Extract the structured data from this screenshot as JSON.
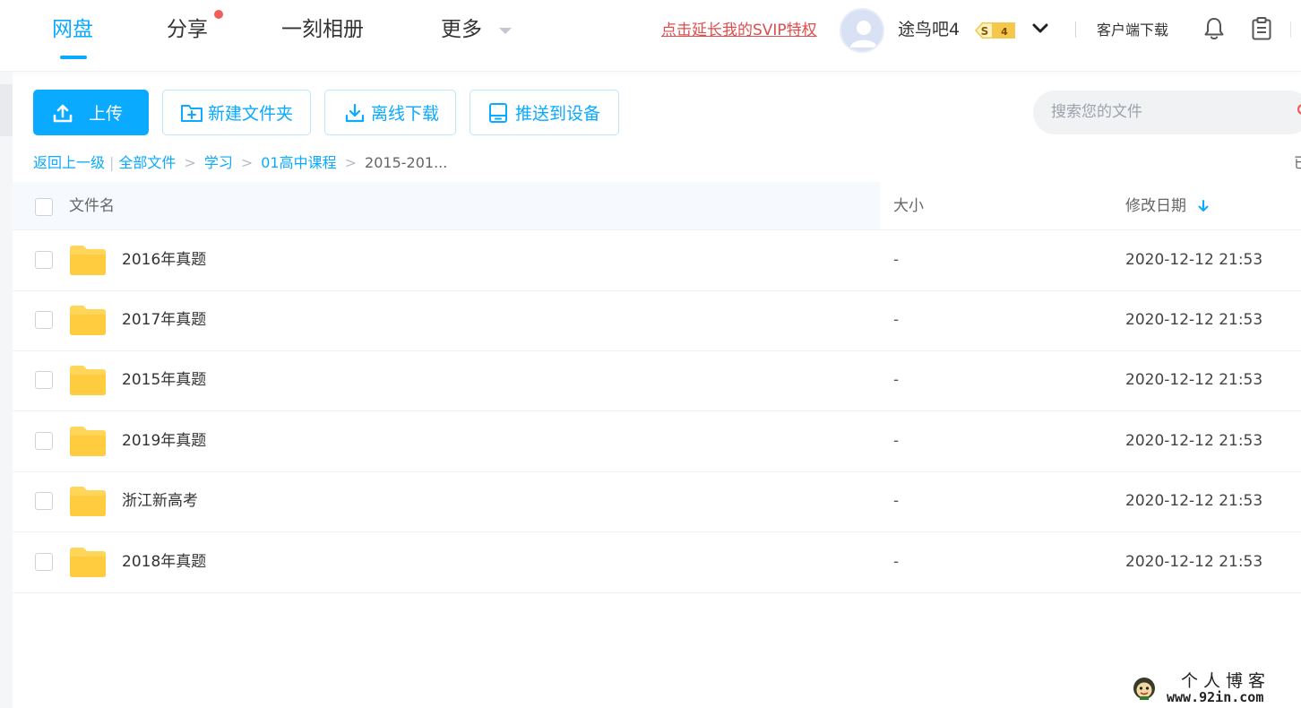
{
  "nav": {
    "tabs": [
      {
        "label": "网盘",
        "active": true
      },
      {
        "label": "分享",
        "has_notification_dot": true
      },
      {
        "label": "一刻相册"
      },
      {
        "label": "更多",
        "has_dropdown": true
      }
    ]
  },
  "header": {
    "svip_link": "点击延长我的SVIP特权",
    "username": "途鸟吧4",
    "vip_badge": {
      "letter": "S",
      "level": "4"
    },
    "client_download": "客户端下载"
  },
  "toolbar": {
    "upload": "上传",
    "new_folder": "新建文件夹",
    "offline_download": "离线下载",
    "push_to_device": "推送到设备"
  },
  "search": {
    "placeholder": "搜索您的文件"
  },
  "breadcrumb": {
    "back": "返回上一级",
    "items": [
      "全部文件",
      "学习",
      "01高中课程"
    ],
    "current": "2015-201...",
    "right_status": "已"
  },
  "table": {
    "columns": {
      "name": "文件名",
      "size": "大小",
      "modified": "修改日期"
    },
    "rows": [
      {
        "name": "2016年真题",
        "size": "-",
        "modified": "2020-12-12 21:53"
      },
      {
        "name": "2017年真题",
        "size": "-",
        "modified": "2020-12-12 21:53"
      },
      {
        "name": "2015年真题",
        "size": "-",
        "modified": "2020-12-12 21:53"
      },
      {
        "name": "2019年真题",
        "size": "-",
        "modified": "2020-12-12 21:53"
      },
      {
        "name": "浙江新高考",
        "size": "-",
        "modified": "2020-12-12 21:53"
      },
      {
        "name": "2018年真题",
        "size": "-",
        "modified": "2020-12-12 21:53"
      }
    ]
  },
  "watermark": {
    "title": "个人博客",
    "url": "www.92in.com"
  },
  "colors": {
    "accent": "#09aaff",
    "notification": "#f25d59",
    "svip_link": "#e04c4c",
    "folder": "#ffd659",
    "badge": "#f5c84c"
  }
}
